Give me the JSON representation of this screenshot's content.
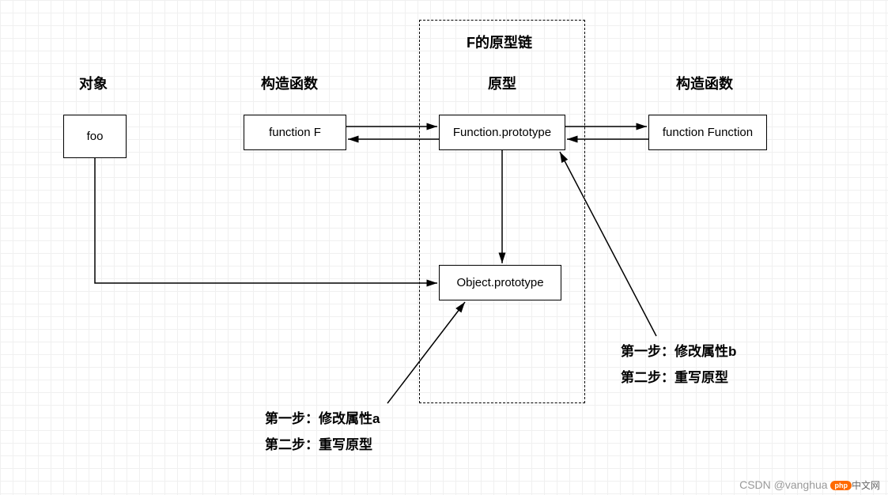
{
  "chart_data": {
    "type": "diagram",
    "title": "F的原型链",
    "columns": [
      "对象",
      "构造函数",
      "原型",
      "构造函数"
    ],
    "nodes": [
      {
        "id": "foo",
        "label": "foo",
        "column": "对象"
      },
      {
        "id": "functionF",
        "label": "function F",
        "column": "构造函数"
      },
      {
        "id": "FunctionPrototype",
        "label": "Function.prototype",
        "column": "原型"
      },
      {
        "id": "functionFunction",
        "label": "function Function",
        "column": "构造函数"
      },
      {
        "id": "ObjectPrototype",
        "label": "Object.prototype",
        "column": "原型"
      }
    ],
    "edges": [
      {
        "from": "functionF",
        "to": "FunctionPrototype",
        "bidirectional": true
      },
      {
        "from": "FunctionPrototype",
        "to": "functionFunction",
        "bidirectional": true
      },
      {
        "from": "FunctionPrototype",
        "to": "ObjectPrototype"
      },
      {
        "from": "foo",
        "to": "ObjectPrototype"
      }
    ],
    "annotations": [
      {
        "target": "ObjectPrototype",
        "lines": [
          "第一步：修改属性a",
          "第二步：重写原型"
        ]
      },
      {
        "target": "FunctionPrototype",
        "lines": [
          "第一步：修改属性b",
          "第二步：重写原型"
        ]
      }
    ]
  },
  "headers": {
    "col1": "对象",
    "col2": "构造函数",
    "col3_title": "F的原型链",
    "col3": "原型",
    "col4": "构造函数"
  },
  "nodes": {
    "foo": "foo",
    "functionF": "function F",
    "functionProto": "Function.prototype",
    "functionFunction": "function Function",
    "objectProto": "Object.prototype"
  },
  "anno_left": {
    "line1": "第一步：修改属性a",
    "line2": "第二步：重写原型"
  },
  "anno_right": {
    "line1": "第一步：修改属性b",
    "line2": "第二步：重写原型"
  },
  "watermark": {
    "csdn": "CSDN @vanghua",
    "logo": "php",
    "suffix": "中文网"
  }
}
